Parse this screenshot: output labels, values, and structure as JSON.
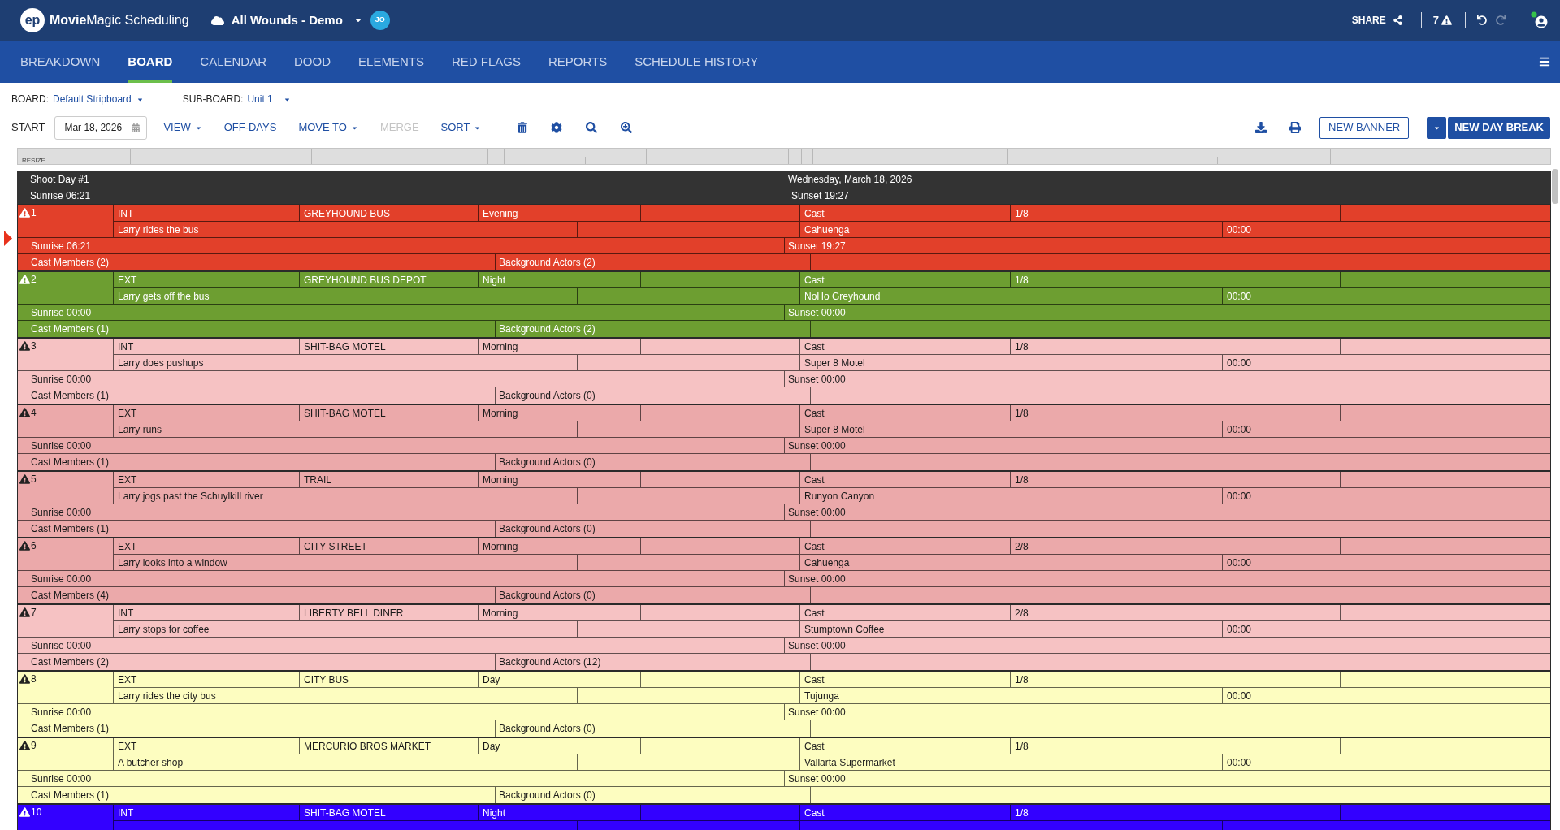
{
  "app": {
    "logo_mark": "ep",
    "title": "**Movie**Magic Scheduling"
  },
  "project": {
    "name": "All Wounds - Demo",
    "user_initials": "JO"
  },
  "header_actions": {
    "share": "SHARE",
    "warning_count": "7",
    "undo_disabled": false,
    "redo_disabled": true
  },
  "nav": [
    {
      "label": "BREAKDOWN",
      "selected": false
    },
    {
      "label": "BOARD",
      "selected": true
    },
    {
      "label": "CALENDAR",
      "selected": false
    },
    {
      "label": "DOOD",
      "selected": false
    },
    {
      "label": "ELEMENTS",
      "selected": false
    },
    {
      "label": "RED FLAGS",
      "selected": false
    },
    {
      "label": "REPORTS",
      "selected": false
    },
    {
      "label": "SCHEDULE HISTORY",
      "selected": false
    }
  ],
  "board_selector": {
    "label": "BOARD:",
    "value": "Default Stripboard"
  },
  "sub_board_selector": {
    "label": "SUB-BOARD:",
    "value": "Unit 1"
  },
  "toolbar": {
    "start_label": "START",
    "start_date": "Mar 18, 2026",
    "menus": [
      {
        "label": "VIEW",
        "dropdown": true,
        "disabled": false
      },
      {
        "label": "OFF-DAYS",
        "dropdown": false,
        "disabled": false
      },
      {
        "label": "MOVE TO",
        "dropdown": true,
        "disabled": false
      },
      {
        "label": "MERGE",
        "dropdown": false,
        "disabled": true
      },
      {
        "label": "SORT",
        "dropdown": true,
        "disabled": false
      }
    ],
    "buttons": [
      {
        "label": "NEW BANNER",
        "kind": "outline"
      },
      {
        "label": "NEW DAY BREAK",
        "kind": "split"
      }
    ]
  },
  "stripboard": {
    "resize_label": "RESIZE",
    "day_banner": {
      "title": "Shoot Day #1",
      "date": "Wednesday, March 18, 2026",
      "sunrise": "Sunrise 06:21",
      "sunset": "Sunset 19:27"
    },
    "strips": [
      {
        "number": "1",
        "color": "#e2402a",
        "int_ext": "INT",
        "set": "GREYHOUND BUS",
        "time": "Evening",
        "cast_label": "Cast",
        "pages": "1/8",
        "description": "Larry rides the bus",
        "location": "Cahuenga",
        "duration": "00:00",
        "sunrise": "Sunrise 06:21",
        "sunset": "Sunset 19:27",
        "cast_members": "Cast Members (2)",
        "background_actors": "Background Actors (2)"
      },
      {
        "number": "2",
        "color": "#6d9e31",
        "int_ext": "EXT",
        "set": "GREYHOUND BUS DEPOT",
        "time": "Night",
        "cast_label": "Cast",
        "pages": "1/8",
        "description": "Larry gets off the bus",
        "location": "NoHo Greyhound",
        "duration": "00:00",
        "sunrise": "Sunrise 00:00",
        "sunset": "Sunset 00:00",
        "cast_members": "Cast Members (1)",
        "background_actors": "Background Actors (2)"
      },
      {
        "number": "3",
        "color": "#f6c2c3",
        "int_ext": "INT",
        "set": "SHIT-BAG MOTEL",
        "time": "Morning",
        "cast_label": "Cast",
        "pages": "1/8",
        "description": "Larry does pushups",
        "location": "Super 8 Motel",
        "duration": "00:00",
        "sunrise": "Sunrise 00:00",
        "sunset": "Sunset 00:00",
        "cast_members": "Cast Members (1)",
        "background_actors": "Background Actors (0)"
      },
      {
        "number": "4",
        "color": "#eba9aa",
        "int_ext": "EXT",
        "set": "SHIT-BAG MOTEL",
        "time": "Morning",
        "cast_label": "Cast",
        "pages": "1/8",
        "description": "Larry runs",
        "location": "Super 8 Motel",
        "duration": "00:00",
        "sunrise": "Sunrise 00:00",
        "sunset": "Sunset 00:00",
        "cast_members": "Cast Members (1)",
        "background_actors": "Background Actors (0)"
      },
      {
        "number": "5",
        "color": "#eba9aa",
        "int_ext": "EXT",
        "set": "TRAIL",
        "time": "Morning",
        "cast_label": "Cast",
        "pages": "1/8",
        "description": "Larry jogs past the Schuylkill river",
        "location": "Runyon Canyon",
        "duration": "00:00",
        "sunrise": "Sunrise 00:00",
        "sunset": "Sunset 00:00",
        "cast_members": "Cast Members (1)",
        "background_actors": "Background Actors (0)"
      },
      {
        "number": "6",
        "color": "#eba9aa",
        "int_ext": "EXT",
        "set": "CITY STREET",
        "time": "Morning",
        "cast_label": "Cast",
        "pages": "2/8",
        "description": "Larry looks into a window",
        "location": "Cahuenga",
        "duration": "00:00",
        "sunrise": "Sunrise 00:00",
        "sunset": "Sunset 00:00",
        "cast_members": "Cast Members (4)",
        "background_actors": "Background Actors (0)"
      },
      {
        "number": "7",
        "color": "#f6c2c3",
        "int_ext": "INT",
        "set": "LIBERTY BELL DINER",
        "time": "Morning",
        "cast_label": "Cast",
        "pages": "2/8",
        "description": "Larry stops for coffee",
        "location": "Stumptown Coffee",
        "duration": "00:00",
        "sunrise": "Sunrise 00:00",
        "sunset": "Sunset 00:00",
        "cast_members": "Cast Members (2)",
        "background_actors": "Background Actors (12)"
      },
      {
        "number": "8",
        "color": "#fdfdc0",
        "int_ext": "EXT",
        "set": "CITY BUS",
        "time": "Day",
        "cast_label": "Cast",
        "pages": "1/8",
        "description": "Larry rides the city bus",
        "location": "Tujunga",
        "duration": "00:00",
        "sunrise": "Sunrise 00:00",
        "sunset": "Sunset 00:00",
        "cast_members": "Cast Members (1)",
        "background_actors": "Background Actors (0)"
      },
      {
        "number": "9",
        "color": "#fdfdc0",
        "int_ext": "EXT",
        "set": "MERCURIO BROS MARKET",
        "time": "Day",
        "cast_label": "Cast",
        "pages": "1/8",
        "description": "A butcher shop",
        "location": "Vallarta Supermarket",
        "duration": "00:00",
        "sunrise": "Sunrise 00:00",
        "sunset": "Sunset 00:00",
        "cast_members": "Cast Members (1)",
        "background_actors": "Background Actors (0)"
      },
      {
        "number": "10",
        "color": "#3300ff",
        "int_ext": "INT",
        "set": "SHIT-BAG MOTEL",
        "time": "Night",
        "cast_label": "Cast",
        "pages": "1/8"
      }
    ]
  }
}
